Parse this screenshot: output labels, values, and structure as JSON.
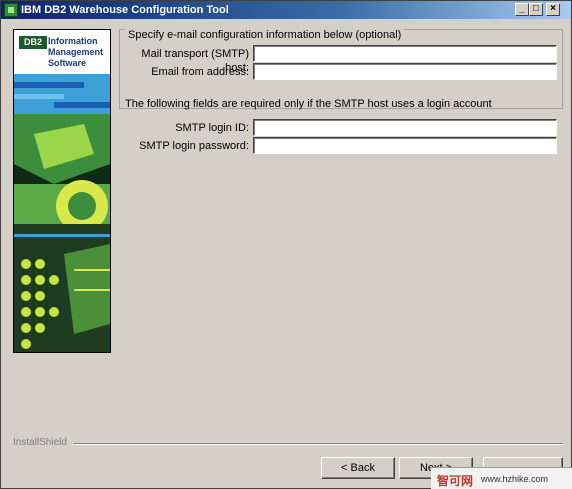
{
  "window": {
    "title": "IBM DB2 Warehouse Configuration Tool"
  },
  "titlebar_buttons": {
    "minimize": "_",
    "maximize": "□",
    "close": "×"
  },
  "side_panel": {
    "badge": "DB2",
    "line1": "Information",
    "line2": "Management",
    "line3": "Software"
  },
  "email_group": {
    "legend": "Specify e-mail configuration information below (optional)",
    "smtp_host_label": "Mail transport (SMTP) host:",
    "smtp_host_value": "",
    "email_from_label": "Email from address:",
    "email_from_value": ""
  },
  "login": {
    "note": "The following fields are required only if the SMTP host uses a login account",
    "login_id_label": "SMTP login ID:",
    "login_id_value": "",
    "password_label": "SMTP login password:",
    "password_value": ""
  },
  "footer": {
    "brand": "InstallShield",
    "back_label": "< Back",
    "next_label": "Next >",
    "third_label": ""
  },
  "watermark": {
    "site_cn": "智可网",
    "url": "www.hzhike.com"
  },
  "colors": {
    "title_start": "#0a246a",
    "title_end": "#a6caf0",
    "window_bg": "#d4d0c8",
    "db2_green": "#1d5a2c"
  }
}
